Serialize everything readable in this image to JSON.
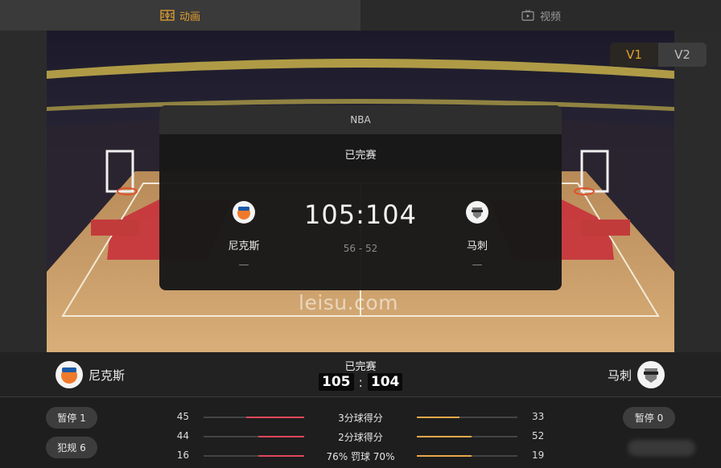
{
  "tabs": [
    {
      "label": "动画",
      "icon": "court-icon",
      "active": true
    },
    {
      "label": "视频",
      "icon": "tv-icon",
      "active": false
    }
  ],
  "version_toggle": {
    "options": [
      "V1",
      "V2"
    ],
    "selected": "V1"
  },
  "watermark": "leisu.com",
  "card": {
    "league": "NBA",
    "status": "已完赛",
    "home": {
      "name": "尼克斯",
      "rank": "—"
    },
    "away": {
      "name": "马刺",
      "rank": "—"
    },
    "score": "105:104",
    "half": "56 - 52"
  },
  "header": {
    "status": "已完赛",
    "home_name": "尼克斯",
    "away_name": "马刺",
    "home_score": "105",
    "away_score": "104",
    "colon": ":"
  },
  "stats": {
    "home_timeout": "暂停 1",
    "home_fouls": "犯规 6",
    "away_timeout": "暂停 0",
    "rows": [
      {
        "label": "3分球得分",
        "home": "45",
        "away": "33",
        "home_frac": 0.577,
        "away_frac": 0.423
      },
      {
        "label": "2分球得分",
        "home": "44",
        "away": "52",
        "home_frac": 0.458,
        "away_frac": 0.542
      },
      {
        "label": "76%  罚球  70%",
        "home": "16",
        "away": "19",
        "home_frac": 0.457,
        "away_frac": 0.543
      }
    ]
  },
  "colors": {
    "accent": "#e0a030",
    "home_bar": "#e0475a",
    "away_bar": "#e8a84a"
  }
}
